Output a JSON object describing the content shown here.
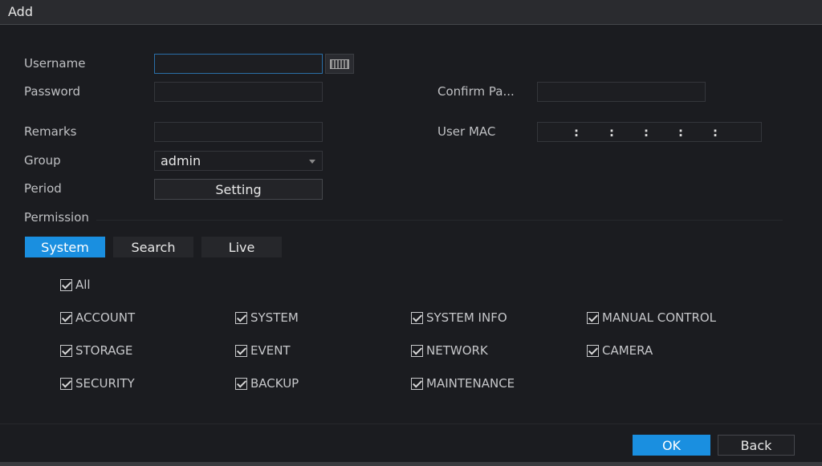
{
  "title": "Add",
  "form": {
    "username_label": "Username",
    "password_label": "Password",
    "confirm_label": "Confirm Pa...",
    "remarks_label": "Remarks",
    "mac_label": "User MAC",
    "group_label": "Group",
    "group_value": "admin",
    "period_label": "Period",
    "setting_button": "Setting",
    "permission_label": "Permission",
    "mac_separator": ":"
  },
  "tabs": [
    "System",
    "Search",
    "Live"
  ],
  "all_label": "All",
  "permissions": [
    "ACCOUNT",
    "SYSTEM",
    "SYSTEM INFO",
    "MANUAL CONTROL",
    "STORAGE",
    "EVENT",
    "NETWORK",
    "CAMERA",
    "SECURITY",
    "BACKUP",
    "MAINTENANCE"
  ],
  "buttons": {
    "ok": "OK",
    "back": "Back"
  },
  "colors": {
    "accent": "#1a8fe0",
    "background": "#1b1c20"
  }
}
